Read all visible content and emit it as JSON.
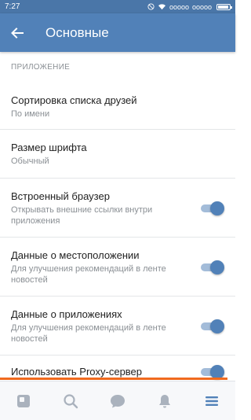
{
  "status_bar": {
    "time": "7:27",
    "signal": "ooooo",
    "signal2": "ooooo"
  },
  "header": {
    "title": "Основные",
    "back_icon": "arrow-left-icon"
  },
  "section": {
    "header": "ПРИЛОЖЕНИЕ"
  },
  "settings": [
    {
      "title": "Сортировка списка друзей",
      "subtitle": "По имени"
    },
    {
      "title": "Размер шрифта",
      "subtitle": "Обычный"
    },
    {
      "title": "Встроенный браузер",
      "subtitle": "Открывать внешние ссылки внутри приложения",
      "toggle": true
    },
    {
      "title": "Данные о местоположении",
      "subtitle": "Для улучшения рекомендаций в ленте новостей",
      "toggle": true
    },
    {
      "title": "Данные о приложениях",
      "subtitle": "Для улучшения рекомендаций в ленте новостей",
      "toggle": true
    },
    {
      "title": "Использовать Proxy-сервер",
      "toggle": true
    }
  ],
  "bottom_nav": [
    {
      "icon": "news-icon"
    },
    {
      "icon": "search-icon"
    },
    {
      "icon": "messages-icon"
    },
    {
      "icon": "notifications-icon"
    },
    {
      "icon": "menu-icon",
      "active": true
    }
  ],
  "colors": {
    "status_bar": "#4a76a8",
    "app_bar": "#5181b8",
    "toggle_on": "#5181b8",
    "toggle_track": "#a3bcd9",
    "accent_line": "#f06a1e",
    "nav_inactive": "#aab2bd",
    "nav_active": "#5181b8"
  }
}
